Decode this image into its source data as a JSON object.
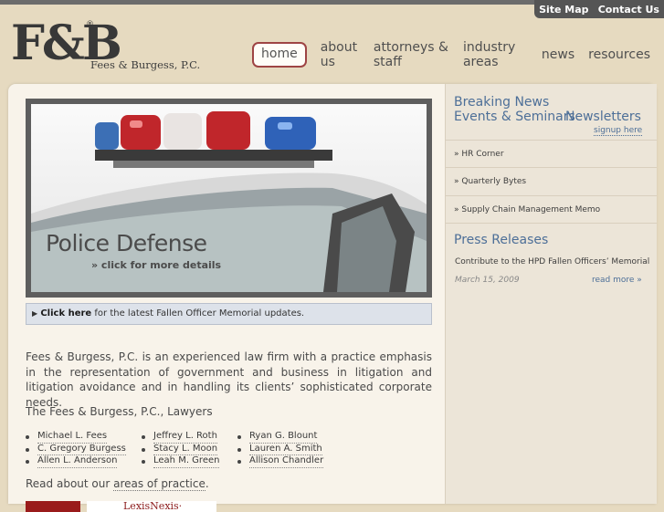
{
  "utility": {
    "site_map": "Site Map",
    "contact_us": "Contact Us"
  },
  "logo": {
    "mark": "F&B",
    "reg": "®",
    "name": "Fees & Burgess, P.C."
  },
  "nav": [
    {
      "label": "home",
      "active": true
    },
    {
      "label": "about us"
    },
    {
      "label": "attorneys & staff"
    },
    {
      "label": "industry areas"
    },
    {
      "label": "news"
    },
    {
      "label": "resources"
    }
  ],
  "banner": {
    "title": "Police Defense",
    "cta": "» click for more details"
  },
  "notice": {
    "click": "Click here",
    "text": " for the latest Fallen Officer Memorial updates."
  },
  "intro": "Fees & Burgess, P.C. is an experienced law firm with a practice emphasis in the representation of government and business in litigation and litigation avoidance and in handling its clients’ sophisticated corporate needs.",
  "lawyers_heading": "The Fees & Burgess, P.C., Lawyers",
  "lawyers": {
    "col1": [
      "Michael L. Fees",
      "C. Gregory Burgess",
      "Allen L. Anderson"
    ],
    "col2": [
      "Jeffrey L. Roth",
      "Stacy L. Moon",
      "Leah M. Green"
    ],
    "col3": [
      "Ryan G. Blount",
      "Lauren A. Smith",
      "Allison Chandler"
    ]
  },
  "areas": {
    "prefix": "Read about our ",
    "link": "areas of practice",
    "suffix": "."
  },
  "partner_logo": "LexisNexis·",
  "sidebar": {
    "breaking_news": "Breaking News",
    "events": "Events & Seminars",
    "newsletters": "Newsletters",
    "signup": "signup here",
    "items": [
      "» HR Corner",
      "» Quarterly Bytes",
      "» Supply Chain Management Memo"
    ],
    "press_heading": "Press Releases",
    "press_item": "Contribute to the HPD Fallen Officers’ Memorial",
    "press_date": "March 15, 2009",
    "read_more": "read more »"
  },
  "colors": {
    "accent_blue": "#4d6f98",
    "nav_active_border": "#9e4444",
    "background": "#e6dac0"
  }
}
